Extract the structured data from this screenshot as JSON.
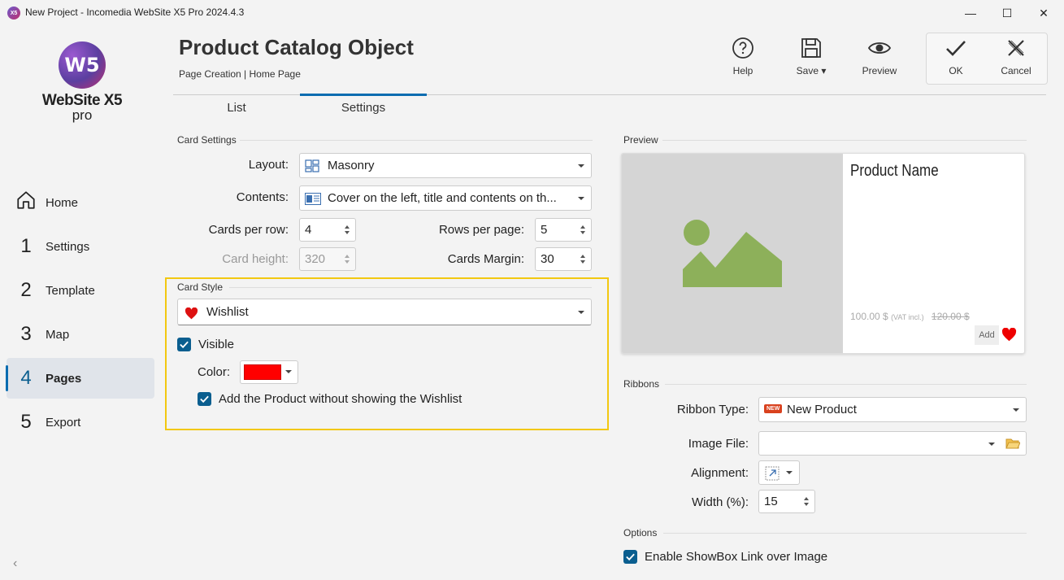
{
  "window": {
    "icon_text": "X5",
    "title": "New Project - Incomedia WebSite X5 Pro 2024.4.3",
    "minimize": "—",
    "maximize": "☐",
    "close": "✕"
  },
  "logo": {
    "mark": "W5",
    "name": "WebSite X5",
    "edition": "pro"
  },
  "nav": {
    "items": [
      {
        "num": "",
        "label": "Home"
      },
      {
        "num": "1",
        "label": "Settings"
      },
      {
        "num": "2",
        "label": "Template"
      },
      {
        "num": "3",
        "label": "Map"
      },
      {
        "num": "4",
        "label": "Pages"
      },
      {
        "num": "5",
        "label": "Export"
      }
    ],
    "active_index": 4,
    "collapse": "‹"
  },
  "header": {
    "title": "Product Catalog Object",
    "breadcrumb": "Page Creation | Home Page"
  },
  "toolbar": {
    "help": "Help",
    "save": "Save",
    "preview": "Preview",
    "ok": "OK",
    "cancel": "Cancel"
  },
  "tabs": {
    "list": "List",
    "settings": "Settings",
    "active": "Settings"
  },
  "card_settings": {
    "section": "Card Settings",
    "layout_label": "Layout:",
    "layout_value": "Masonry",
    "contents_label": "Contents:",
    "contents_value": "Cover on the left, title and contents on th...",
    "cards_per_row_label": "Cards per row:",
    "cards_per_row": "4",
    "rows_per_page_label": "Rows per page:",
    "rows_per_page": "5",
    "card_height_label": "Card height:",
    "card_height": "320",
    "cards_margin_label": "Cards Margin:",
    "cards_margin": "30"
  },
  "card_style": {
    "section": "Card Style",
    "style_value": "Wishlist",
    "visible_label": "Visible",
    "visible": true,
    "color_label": "Color:",
    "color": "#ff0000",
    "add_without_label": "Add the Product without showing the Wishlist",
    "add_without": true
  },
  "preview": {
    "section": "Preview",
    "product_name": "Product Name",
    "price": "100.00 $",
    "vat": "(VAT incl.)",
    "old_price": "120.00 $",
    "add": "Add"
  },
  "ribbons": {
    "section": "Ribbons",
    "type_label": "Ribbon Type:",
    "type_badge": "NEW",
    "type_value": "New Product",
    "image_label": "Image File:",
    "image_value": "",
    "alignment_label": "Alignment:",
    "width_label": "Width (%):",
    "width": "15"
  },
  "options": {
    "section": "Options",
    "showbox_label": "Enable ShowBox Link over Image",
    "showbox": true
  },
  "colors": {
    "accent": "#0a6cb0",
    "highlight": "#f2c811",
    "heart": "#e00000",
    "image_green": "#8db05a"
  }
}
